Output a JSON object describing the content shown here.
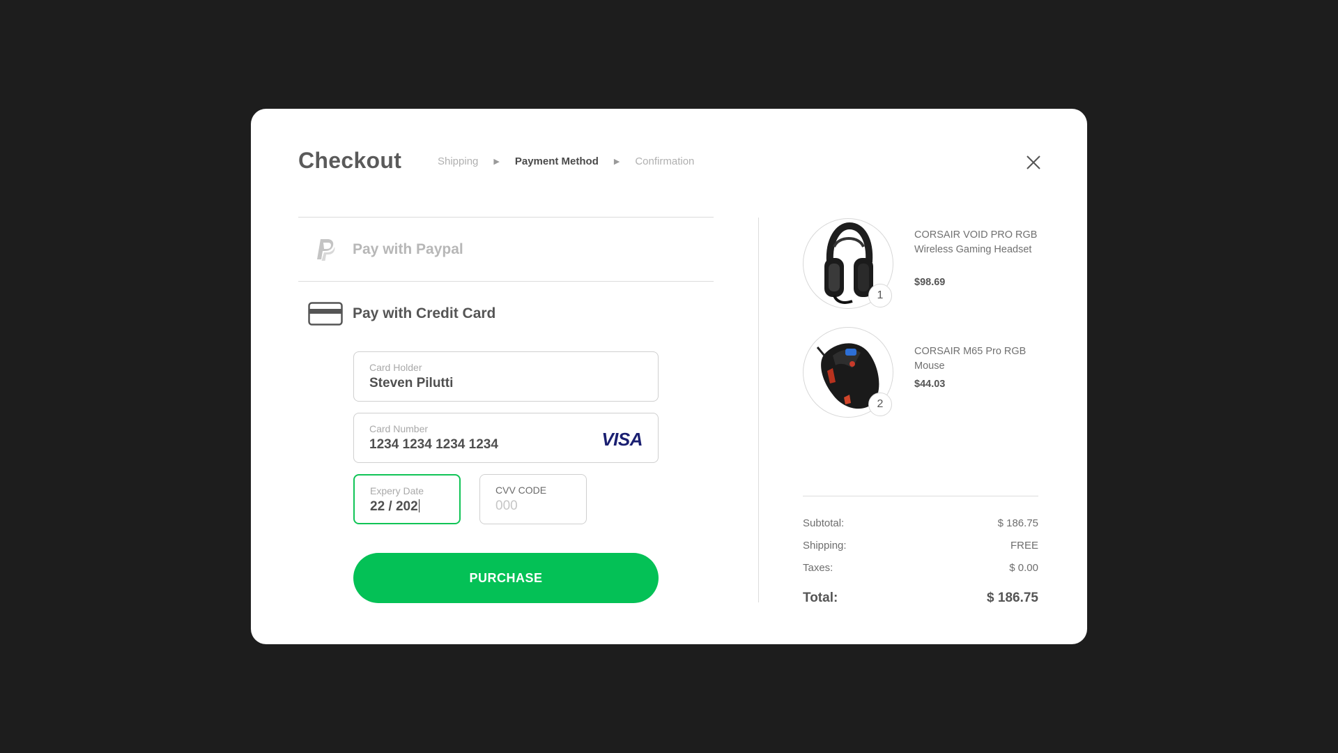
{
  "header": {
    "title": "Checkout",
    "steps": [
      "Shipping",
      "Payment Method",
      "Confirmation"
    ],
    "active_step": "Payment Method"
  },
  "payment_methods": {
    "paypal_label": "Pay with Paypal",
    "card_label": "Pay with Credit Card"
  },
  "card_form": {
    "holder_label": "Card Holder",
    "holder_value": "Steven Pilutti",
    "number_label": "Card Number",
    "number_value": "1234 1234 1234 1234",
    "brand": "VISA",
    "expiry_label": "Expery Date",
    "expiry_value": "22 / 202",
    "cvv_label": "CVV CODE",
    "cvv_placeholder": "000"
  },
  "purchase_label": "PURCHASE",
  "cart": {
    "items": [
      {
        "name": "CORSAIR VOID PRO RGB Wireless Gaming Headset",
        "price": "$98.69",
        "qty": "1",
        "icon": "headset-icon"
      },
      {
        "name": "CORSAIR M65 Pro RGB Mouse",
        "price": "$44.03",
        "qty": "2",
        "icon": "mouse-icon"
      }
    ]
  },
  "summary": {
    "subtotal_label": "Subtotal:",
    "subtotal_value": "$ 186.75",
    "shipping_label": "Shipping:",
    "shipping_value": "FREE",
    "taxes_label": "Taxes:",
    "taxes_value": "$ 0.00",
    "total_label": "Total:",
    "total_value": "$ 186.75"
  },
  "colors": {
    "accent": "#04c156",
    "focus_border": "#10c456",
    "background": "#1d1d1d",
    "visa": "#1a1f71"
  }
}
